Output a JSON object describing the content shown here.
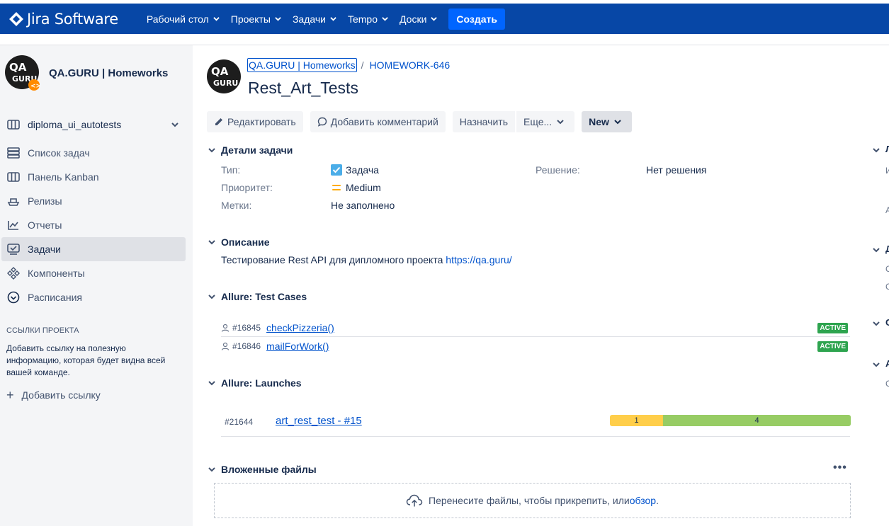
{
  "app": {
    "logo_text": "Jira Software"
  },
  "nav": {
    "items": [
      "Рабочий стол",
      "Проекты",
      "Задачи",
      "Tempo",
      "Доски"
    ],
    "create_label": "Создать"
  },
  "sidebar": {
    "project_name": "QA.GURU | Homeworks",
    "board_name": "diploma_ui_autotests",
    "items": [
      {
        "label": "Список задач",
        "icon": "backlog-icon"
      },
      {
        "label": "Панель Kanban",
        "icon": "board-icon"
      },
      {
        "label": "Релизы",
        "icon": "ship-icon"
      },
      {
        "label": "Отчеты",
        "icon": "reports-icon"
      },
      {
        "label": "Задачи",
        "icon": "issues-icon",
        "active": true
      },
      {
        "label": "Компоненты",
        "icon": "components-icon"
      },
      {
        "label": "Расписания",
        "icon": "schedule-icon"
      }
    ],
    "links_title": "ССЫЛКИ ПРОЕКТА",
    "links_text": "Добавить ссылку на полезную информацию, которая будет видна всей вашей команде.",
    "add_link_label": "Добавить ссылку"
  },
  "issue": {
    "breadcrumb_project": "QA.GURU | Homeworks",
    "breadcrumb_sep": "/",
    "key": "HOMEWORK-646",
    "title": "Rest_Art_Tests"
  },
  "toolbar": {
    "edit": "Редактировать",
    "comment": "Добавить комментарий",
    "assign": "Назначить",
    "more": "Еще...",
    "status": "New"
  },
  "details": {
    "title": "Детали задачи",
    "type_label": "Тип:",
    "type_value": "Задача",
    "priority_label": "Приоритет:",
    "priority_value": "Medium",
    "labels_label": "Метки:",
    "labels_value": "Не заполнено",
    "resolution_label": "Решение:",
    "resolution_value": "Нет решения"
  },
  "description": {
    "title": "Описание",
    "text": "Тестирование Rest API для дипломного проекта ",
    "link": "https://qa.guru/"
  },
  "test_cases": {
    "title": "Allure: Test Cases",
    "rows": [
      {
        "id": "#16845",
        "name": "checkPizzeria()",
        "status": "ACTIVE"
      },
      {
        "id": "#16846",
        "name": "mailForWork()",
        "status": "ACTIVE"
      }
    ]
  },
  "launches": {
    "title": "Allure: Launches",
    "rows": [
      {
        "id": "#21644",
        "name": "art_rest_test - #15",
        "broken": "1",
        "passed": "4"
      }
    ]
  },
  "attachments": {
    "title": "Вложенные файлы",
    "more": "•••",
    "drop_text": "Перенесите файлы, чтобы прикрепить, или ",
    "browse": "обзор",
    "dot": "."
  },
  "right_col": {
    "letters": [
      "Л",
      "И",
      "А",
      "Д",
      "С",
      "С",
      "С",
      "А",
      "С"
    ]
  },
  "colors": {
    "nav_bg": "#0747a6",
    "create_btn": "#0065ff",
    "link": "#0052cc",
    "badge_active": "#2ea44f",
    "bar_broken": "#ffce4a",
    "bar_passed": "#97cc64"
  }
}
